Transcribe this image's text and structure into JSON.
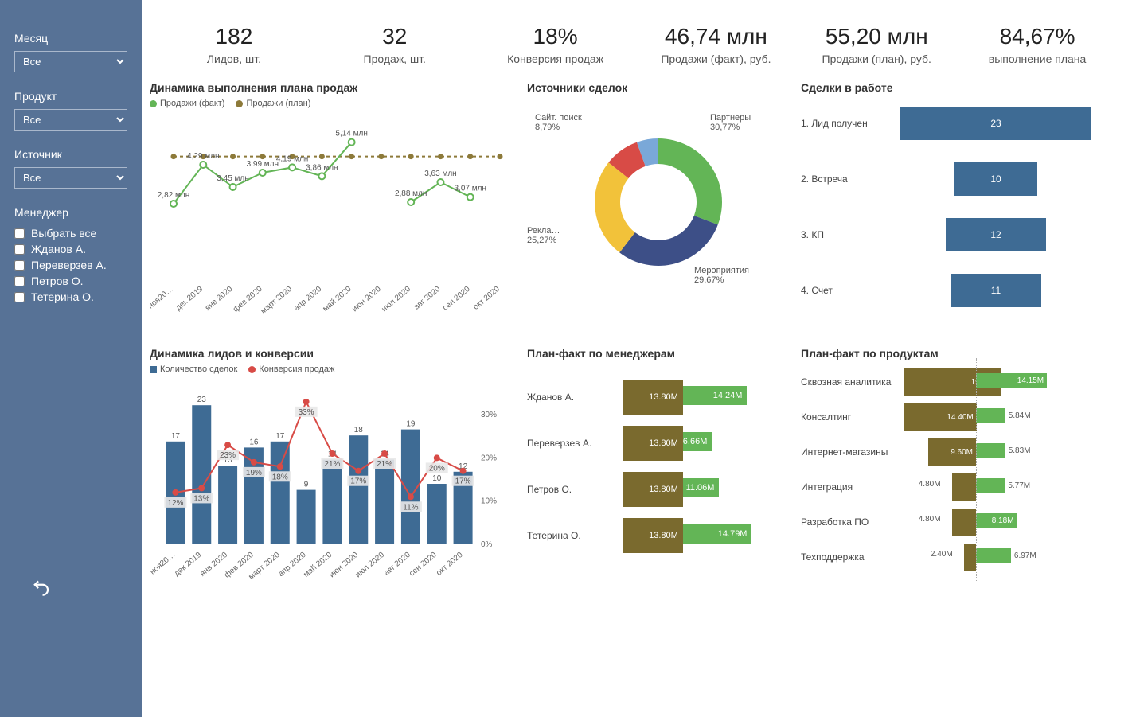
{
  "sidebar": {
    "filters": {
      "month": {
        "label": "Месяц",
        "value": "Все"
      },
      "product": {
        "label": "Продукт",
        "value": "Все"
      },
      "source": {
        "label": "Источник",
        "value": "Все"
      }
    },
    "manager_label": "Менеджер",
    "managers": [
      "Выбрать все",
      "Жданов А.",
      "Переверзев А.",
      "Петров О.",
      "Тетерина О."
    ]
  },
  "kpis": [
    {
      "value": "182",
      "label": "Лидов, шт."
    },
    {
      "value": "32",
      "label": "Продаж, шт."
    },
    {
      "value": "18%",
      "label": "Конверсия продаж"
    },
    {
      "value": "46,74 млн",
      "label": "Продажи (факт), руб."
    },
    {
      "value": "55,20 млн",
      "label": "Продажи (план), руб."
    },
    {
      "value": "84,67%",
      "label": "выполнение плана"
    }
  ],
  "charts": {
    "plan_dyn": {
      "title": "Динамика выполнения плана продаж",
      "legend_fact": "Продажи (факт)",
      "legend_plan": "Продажи (план)"
    },
    "sources": {
      "title": "Источники сделок"
    },
    "funnel": {
      "title": "Сделки в работе"
    },
    "leads_conv": {
      "title": "Динамика лидов и конверсии",
      "legend_deals": "Количество сделок",
      "legend_conv": "Конверсия продаж",
      "y2_ticks": [
        "30%",
        "20%",
        "10%",
        "0%"
      ]
    },
    "pf_managers": {
      "title": "План-факт по менеджерам"
    },
    "pf_products": {
      "title": "План-факт по продуктам"
    }
  },
  "chart_data": [
    {
      "id": "plan_dyn",
      "type": "line",
      "categories": [
        "ноя20…",
        "дек 2019",
        "янв 2020",
        "фев 2020",
        "март 2020",
        "апр 2020",
        "май 2020",
        "июн 2020",
        "июл 2020",
        "авг 2020",
        "сен 2020",
        "окт 2020"
      ],
      "series": [
        {
          "name": "Продажи (факт)",
          "values": [
            2.82,
            4.29,
            3.45,
            3.99,
            4.19,
            3.86,
            5.14,
            null,
            2.88,
            3.63,
            3.07,
            null
          ],
          "labels": [
            "2,82 млн",
            "4,29 млн",
            "3,45 млн",
            "3,99 млн",
            "4,19 млн",
            "3,86 млн",
            "5,14 млн",
            "",
            "2,88 млн",
            "3,63 млн",
            "3,07 млн",
            ""
          ],
          "color": "#63b556"
        },
        {
          "name": "Продажи (план)",
          "values": [
            4.6,
            4.6,
            4.6,
            4.6,
            4.6,
            4.6,
            4.6,
            4.6,
            4.6,
            4.6,
            4.6,
            4.6
          ],
          "color": "#8d7a3a"
        }
      ],
      "ylim": [
        0,
        6
      ]
    },
    {
      "id": "sources",
      "type": "pie",
      "slices": [
        {
          "name": "Партнеры",
          "value": 30.77,
          "label": "Партнеры\n30,77%",
          "color": "#63b556"
        },
        {
          "name": "Мероприятия",
          "value": 29.67,
          "label": "Мероприятия\n29,67%",
          "color": "#3d4f87"
        },
        {
          "name": "Рекла…",
          "value": 25.27,
          "label": "Рекла…\n25,27%",
          "color": "#f2c23a"
        },
        {
          "name": "Сайт. поиск",
          "value": 8.79,
          "label": "Сайт. поиск\n8,79%",
          "color": "#d84b46"
        },
        {
          "name": "other",
          "value": 5.5,
          "label": "",
          "color": "#7aa8d8"
        }
      ]
    },
    {
      "id": "funnel",
      "type": "bar",
      "categories": [
        "1. Лид получен",
        "2. Встреча",
        "3. КП",
        "4. Счет"
      ],
      "values": [
        23,
        10,
        12,
        11
      ]
    },
    {
      "id": "leads_conv",
      "type": "bar",
      "categories": [
        "ноя20…",
        "дек 2019",
        "янв 2020",
        "фев 2020",
        "март 2020",
        "апр 2020",
        "май 2020",
        "июн 2020",
        "июл 2020",
        "авг 2020",
        "сен 2020",
        "окт 2020"
      ],
      "series": [
        {
          "name": "Количество сделок",
          "values": [
            17,
            23,
            13,
            16,
            17,
            9,
            14,
            18,
            14,
            19,
            10,
            12
          ],
          "color": "#3e6b94"
        },
        {
          "name": "Конверсия продаж",
          "values": [
            12,
            13,
            23,
            19,
            18,
            33,
            21,
            17,
            21,
            11,
            20,
            17
          ],
          "color": "#d84b46",
          "labels": [
            "12%",
            "13%",
            "23%",
            "19%",
            "18%",
            "33%",
            "21%",
            "17%",
            "21%",
            "11%",
            "20%",
            "17%"
          ]
        }
      ],
      "ylim": [
        0,
        25
      ],
      "y2lim": [
        0,
        35
      ]
    },
    {
      "id": "pf_managers",
      "type": "bar",
      "categories": [
        "Жданов А.",
        "Переверзев А.",
        "Петров О.",
        "Тетерина О."
      ],
      "series": [
        {
          "name": "План",
          "values": [
            13.8,
            13.8,
            13.8,
            13.8
          ],
          "labels": [
            "13.80M",
            "13.80M",
            "13.80M",
            "13.80M"
          ],
          "color": "#7a6a2e"
        },
        {
          "name": "Факт",
          "values": [
            14.24,
            6.66,
            11.06,
            14.79
          ],
          "labels": [
            "14.24M",
            "6.66M",
            "11.06M",
            "14.79M"
          ],
          "color": "#63b556"
        }
      ]
    },
    {
      "id": "pf_products",
      "type": "bar",
      "categories": [
        "Сквозная аналитика",
        "Консалтинг",
        "Интернет-магазины",
        "Интеграция",
        "Разработка ПО",
        "Техподдержка"
      ],
      "series": [
        {
          "name": "План",
          "values": [
            19.2,
            14.4,
            9.6,
            4.8,
            4.8,
            2.4
          ],
          "labels": [
            "19.20M",
            "14.40M",
            "9.60M",
            "4.80M",
            "4.80M",
            "2.40M"
          ],
          "color": "#7a6a2e"
        },
        {
          "name": "Факт",
          "values": [
            14.15,
            5.84,
            5.83,
            5.77,
            8.18,
            6.97
          ],
          "labels": [
            "14.15M",
            "5.84M",
            "5.83M",
            "5.77M",
            "8.18M",
            "6.97M"
          ],
          "color": "#63b556"
        }
      ]
    }
  ]
}
